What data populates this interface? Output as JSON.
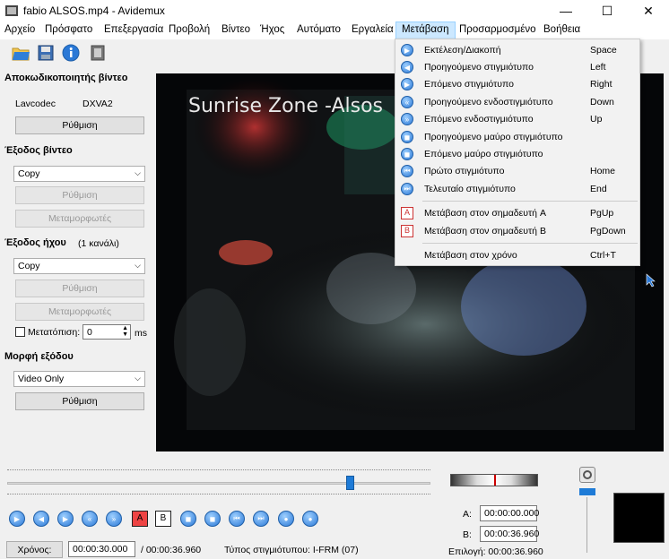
{
  "window": {
    "title": "fabio ALSOS.mp4 - Avidemux"
  },
  "menu": [
    "Αρχείο",
    "Πρόσφατο",
    "Επεξεργασία",
    "Προβολή",
    "Βίντεο",
    "Ήχος",
    "Αυτόματο",
    "Εργαλεία",
    "Μετάβαση",
    "Προσαρμοσμένο",
    "Βοήθεια"
  ],
  "left": {
    "video_decoder": {
      "title": "Αποκωδικοποιητής βίντεο",
      "codec": "Lavcodec",
      "hw": "DXVA2",
      "config": "Ρύθμιση"
    },
    "video_output": {
      "title": "Έξοδος βίντεο",
      "selected": "Copy",
      "config": "Ρύθμιση",
      "filters": "Μεταμορφωτές"
    },
    "audio_output": {
      "title": "Έξοδος ήχου",
      "channels": "(1 κανάλι)",
      "selected": "Copy",
      "config": "Ρύθμιση",
      "filters": "Μεταμορφωτές",
      "shift_label": "Μετατόπιση:",
      "shift_value": "0",
      "shift_unit": "ms"
    },
    "output_format": {
      "title": "Μορφή εξόδου",
      "selected": "Video Only",
      "config": "Ρύθμιση"
    }
  },
  "video": {
    "overlay_text": "Sunrise Zone -Alsos"
  },
  "goto_menu": [
    {
      "label": "Εκτέλεση/Διακοπή",
      "shortcut": "Space",
      "icon": "play-icon"
    },
    {
      "label": "Προηγούμενο στιγμιότυπο",
      "shortcut": "Left",
      "icon": "prev-frame-icon"
    },
    {
      "label": "Επόμενο στιγμιότυπο",
      "shortcut": "Right",
      "icon": "next-frame-icon"
    },
    {
      "label": "Προηγούμενο ενδοστιγμιότυπο",
      "shortcut": "Down",
      "icon": "prev-keyframe-icon"
    },
    {
      "label": "Επόμενο ενδοστιγμιότυπο",
      "shortcut": "Up",
      "icon": "next-keyframe-icon"
    },
    {
      "label": "Προηγούμενο μαύρο στιγμιότυπο",
      "shortcut": "",
      "icon": "prev-black-icon"
    },
    {
      "label": "Επόμενο μαύρο στιγμιότυπο",
      "shortcut": "",
      "icon": "next-black-icon"
    },
    {
      "label": "Πρώτο στιγμιότυπο",
      "shortcut": "Home",
      "icon": "first-frame-icon"
    },
    {
      "label": "Τελευταίο στιγμιότυπο",
      "shortcut": "End",
      "icon": "last-frame-icon"
    },
    {
      "label": "Μετάβαση στον σημαδευτή A",
      "shortcut": "PgUp",
      "icon": "marker-a-icon"
    },
    {
      "label": "Μετάβαση στον σημαδευτή B",
      "shortcut": "PgDown",
      "icon": "marker-b-icon"
    },
    {
      "label": "Μετάβαση στον χρόνο",
      "shortcut": "Ctrl+T",
      "icon": ""
    }
  ],
  "status": {
    "time_button": "Χρόνος:",
    "current_time": "00:00:30.000",
    "total_time": "/ 00:00:36.960",
    "frame_type": "Τύπος στιγμιότυπου:  I-FRM (07)",
    "a_label": "A:",
    "a_value": "00:00:00.000",
    "b_label": "B:",
    "b_value": "00:00:36.960",
    "selection": "Επιλογή: 00:00:36.960"
  },
  "playback": {
    "position_fraction": 0.81
  },
  "markers": {
    "a": "A",
    "b": "B"
  }
}
